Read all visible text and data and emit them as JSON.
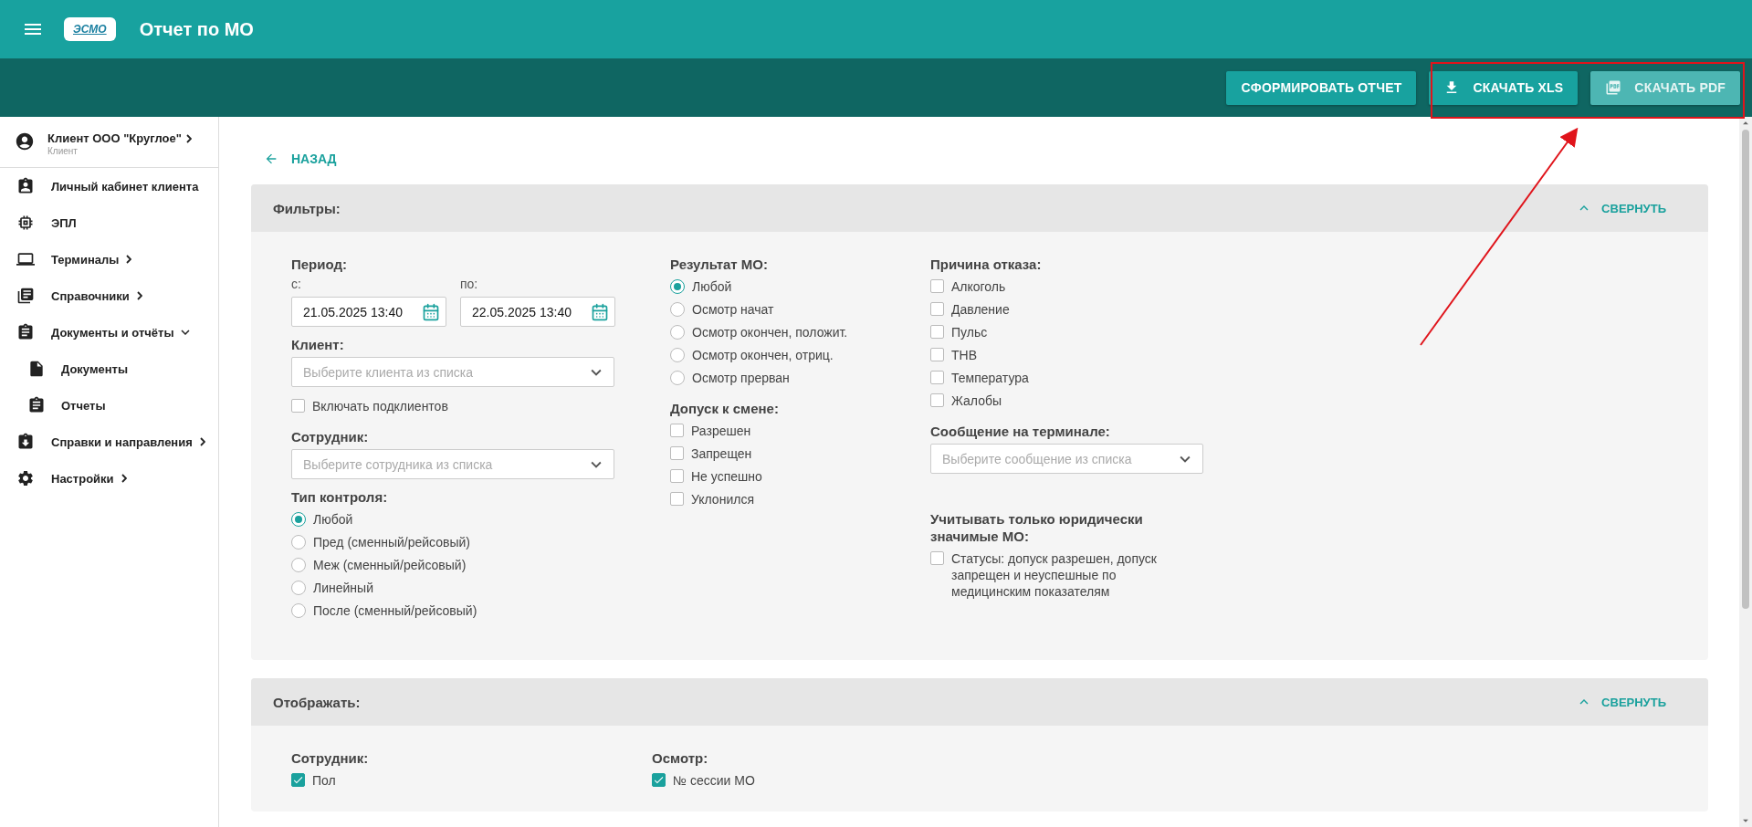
{
  "app": {
    "logo": "ЭСМО",
    "title": "Отчет по МО"
  },
  "toolbar": {
    "buttons": [
      {
        "label": "СФОРМИРОВАТЬ ОТЧЕТ",
        "disabled": false
      },
      {
        "label": "СКАЧАТЬ XLS",
        "disabled": false
      },
      {
        "label": "СКАЧАТЬ PDF",
        "disabled": true
      }
    ]
  },
  "sidebar": {
    "user": {
      "name": "Клиент ООО \"Круглое\"",
      "role": "Клиент"
    },
    "items": [
      {
        "label": "Личный кабинет клиента"
      },
      {
        "label": "ЭПЛ"
      },
      {
        "label": "Терминалы",
        "expanded": false
      },
      {
        "label": "Справочники",
        "expanded": false
      },
      {
        "label": "Документы и отчёты",
        "expanded": true,
        "children": [
          {
            "label": "Документы"
          },
          {
            "label": "Отчеты"
          }
        ]
      },
      {
        "label": "Справки и направления",
        "expanded": false
      },
      {
        "label": "Настройки",
        "expanded": false
      }
    ]
  },
  "back_link": "НАЗАД",
  "filters": {
    "title": "Фильтры:",
    "collapse_label": "СВЕРНУТЬ",
    "columns": [
      [
        {
          "kind": "period",
          "label": "Период:",
          "from_label": "с:",
          "from": "21.05.2025 13:40",
          "to_label": "по:",
          "to": "22.05.2025 13:40"
        },
        {
          "kind": "select",
          "label": "Клиент:",
          "placeholder": "Выберите клиента из списка"
        },
        {
          "kind": "checks",
          "options": [
            {
              "label": "Включать подклиентов",
              "checked": false
            }
          ]
        },
        {
          "kind": "select",
          "label": "Сотрудник:",
          "placeholder": "Выберите сотрудника из списка"
        },
        {
          "kind": "radio",
          "label": "Тип контроля:",
          "options": [
            {
              "label": "Любой",
              "selected": true
            },
            {
              "label": "Пред (сменный/рейсовый)",
              "selected": false
            },
            {
              "label": "Меж (сменный/рейсовый)",
              "selected": false
            },
            {
              "label": "Линейный",
              "selected": false
            },
            {
              "label": "После (сменный/рейсовый)",
              "selected": false
            }
          ]
        }
      ],
      [
        {
          "kind": "radio",
          "label": "Результат МО:",
          "options": [
            {
              "label": "Любой",
              "selected": true
            },
            {
              "label": "Осмотр начат",
              "selected": false
            },
            {
              "label": "Осмотр окончен, положит.",
              "selected": false
            },
            {
              "label": "Осмотр окончен, отриц.",
              "selected": false
            },
            {
              "label": "Осмотр прерван",
              "selected": false
            }
          ]
        },
        {
          "kind": "checks",
          "label": "Допуск к смене:",
          "options": [
            {
              "label": "Разрешен",
              "checked": false
            },
            {
              "label": "Запрещен",
              "checked": false
            },
            {
              "label": "Не успешно",
              "checked": false
            },
            {
              "label": "Уклонился",
              "checked": false
            }
          ]
        }
      ],
      [
        {
          "kind": "checks",
          "label": "Причина отказа:",
          "options": [
            {
              "label": "Алкоголь",
              "checked": false
            },
            {
              "label": "Давление",
              "checked": false
            },
            {
              "label": "Пульс",
              "checked": false
            },
            {
              "label": "ТНВ",
              "checked": false
            },
            {
              "label": "Температура",
              "checked": false
            },
            {
              "label": "Жалобы",
              "checked": false
            }
          ]
        },
        {
          "kind": "select",
          "label": "Сообщение на терминале:",
          "placeholder": "Выберите сообщение из списка"
        },
        {
          "kind": "checks",
          "label": "Учитывать только юридически значимые МО:",
          "options": [
            {
              "label": "Статусы: допуск разрешен, допуск запрещен и неуспешные по медицинским показателям",
              "checked": false
            }
          ]
        }
      ]
    ]
  },
  "display": {
    "title": "Отображать:",
    "collapse_label": "СВЕРНУТЬ",
    "groups": [
      {
        "label": "Сотрудник:",
        "options": [
          {
            "label": "Пол",
            "checked": true
          }
        ]
      },
      {
        "label": "Осмотр:",
        "options": [
          {
            "label": "№ сессии МО",
            "checked": true
          }
        ]
      }
    ]
  }
}
